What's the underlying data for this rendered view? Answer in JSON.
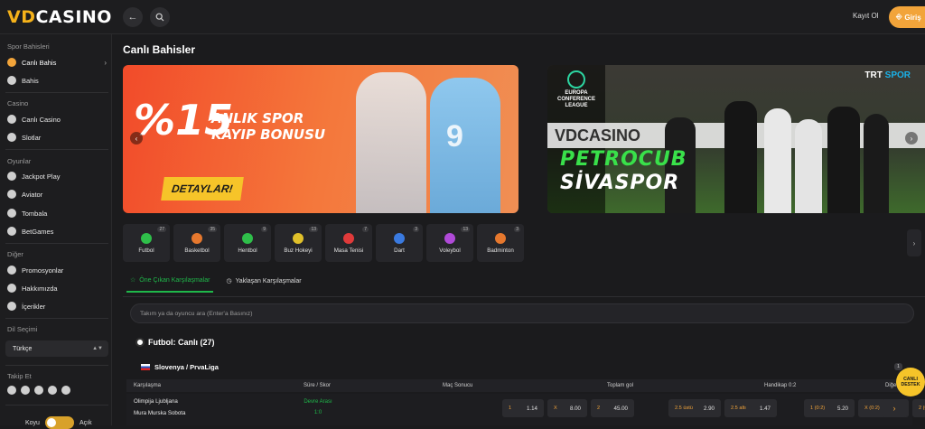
{
  "header": {
    "logo_prefix": "VD",
    "logo_suffix": "CASINO",
    "register_label": "Kayıt Ol",
    "login_label": "Giriş",
    "back_icon": "arrow-left-icon",
    "search_icon": "search-icon"
  },
  "sidebar": {
    "sports_section": "Spor Bahisleri",
    "live_bets": "Canlı Bahis",
    "bets": "Bahis",
    "casino_section": "Casino",
    "live_casino": "Canlı Casino",
    "slots": "Slotlar",
    "games_section": "Oyunlar",
    "jackpot_play": "Jackpot Play",
    "aviator": "Aviator",
    "tombala": "Tombala",
    "betgames": "BetGames",
    "other_section": "Diğer",
    "promotions": "Promosyonlar",
    "about": "Hakkımızda",
    "contents": "İçerikler",
    "language_section": "Dil Seçimi",
    "language_value": "Türkçe",
    "follow_section": "Takip Et",
    "theme_dark": "Koyu",
    "theme_light": "Açık"
  },
  "main": {
    "title": "Canlı Bahisler",
    "banner1": {
      "percent": "%15",
      "line1": "ANLIK SPOR",
      "line2": "KAYIP BONUSU",
      "button": "DETAYLAR!",
      "jersey_number": "9"
    },
    "banner2": {
      "league_line1": "EUROPA",
      "league_line2": "CONFERENCE",
      "league_line3": "LEAGUE",
      "board_text": "VDCASINO",
      "match_line1": "PETROCUB",
      "match_line2": "SİVASPOR",
      "channel": "TRT",
      "channel_suffix": "SPOR"
    },
    "sports": [
      {
        "name": "Futbol",
        "count": "27",
        "color": "#2fbf4a"
      },
      {
        "name": "Basketbol",
        "count": "35",
        "color": "#e6782e"
      },
      {
        "name": "Hentbol",
        "count": "9",
        "color": "#2fbf4a"
      },
      {
        "name": "Buz Hokeyi",
        "count": "13",
        "color": "#e0c02a"
      },
      {
        "name": "Masa Tenisi",
        "count": "7",
        "color": "#e03a3a"
      },
      {
        "name": "Dart",
        "count": "3",
        "color": "#3a7ae0"
      },
      {
        "name": "Voleybol",
        "count": "13",
        "color": "#b04ad8"
      },
      {
        "name": "Badminton",
        "count": "3",
        "color": "#e6782e"
      }
    ],
    "tabs": {
      "featured": "Öne Çıkan Karşılaşmalar",
      "upcoming": "Yaklaşan Karşılaşmalar"
    },
    "search_placeholder": "Takım ya da oyuncu ara (Enter'a Basınız)",
    "live_header": "Futbol: Canlı (27)",
    "league": "Slovenya / PrvaLiga",
    "league_count": "1",
    "table": {
      "col_match": "Karşılaşma",
      "col_time": "Süre / Skor",
      "col_result": "Maç Sonucu",
      "col_total": "Toplam gol",
      "col_handicap": "Handikap 0:2",
      "col_other": "Diğer"
    },
    "match": {
      "home": "Olimpija Ljubljana",
      "away": "Mura Murska Sobota",
      "status": "Devre Arası",
      "score": "1:0",
      "odds": [
        {
          "label": "1",
          "value": "1.14"
        },
        {
          "label": "X",
          "value": "8.00"
        },
        {
          "label": "2",
          "value": "45.00"
        },
        {
          "label": "2.5 üstü",
          "value": "2.90"
        },
        {
          "label": "2.5 altı",
          "value": "1.47"
        },
        {
          "label": "1 (0:2)",
          "value": "5.20"
        },
        {
          "label": "X (0:2)",
          "value": "2.95"
        },
        {
          "label": "2 (0:2)",
          "value": "1.75"
        }
      ]
    },
    "support_line1": "CANLI",
    "support_line2": "DESTEK"
  }
}
